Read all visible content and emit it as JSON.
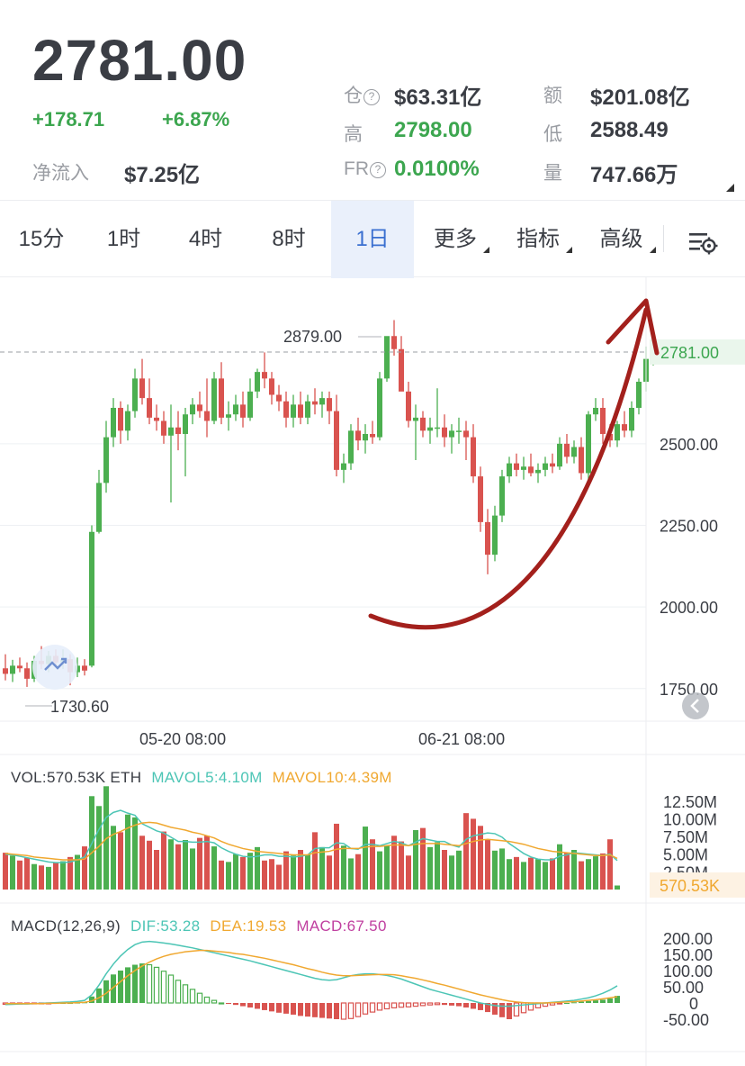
{
  "header": {
    "last_price": "2781.00",
    "change": "+178.71",
    "change_pct": "+6.87%",
    "net_inflow_label": "净流入",
    "net_inflow_value": "$7.25亿",
    "stats": [
      {
        "label": "仓",
        "has_info": true,
        "value": "$63.31亿",
        "color": "dark"
      },
      {
        "label": "额",
        "has_info": false,
        "value": "$201.08亿",
        "color": "dark"
      },
      {
        "label": "高",
        "has_info": false,
        "value": "2798.00",
        "color": "green"
      },
      {
        "label": "低",
        "has_info": false,
        "value": "2588.49",
        "color": "dark"
      },
      {
        "label": "FR",
        "has_info": true,
        "value": "0.0100%",
        "color": "green"
      },
      {
        "label": "量",
        "has_info": false,
        "value": "747.66万",
        "color": "dark"
      }
    ]
  },
  "tabs": [
    {
      "label": "15分",
      "active": false,
      "dropdown": false
    },
    {
      "label": "1时",
      "active": false,
      "dropdown": false
    },
    {
      "label": "4时",
      "active": false,
      "dropdown": false
    },
    {
      "label": "8时",
      "active": false,
      "dropdown": false
    },
    {
      "label": "1日",
      "active": true,
      "dropdown": false
    },
    {
      "label": "更多",
      "active": false,
      "dropdown": true
    },
    {
      "label": "指标",
      "active": false,
      "dropdown": true
    },
    {
      "label": "高级",
      "active": false,
      "dropdown": true
    }
  ],
  "settings_icon": "chart-settings-icon",
  "colors": {
    "up": "#4caf50",
    "down": "#d9534f",
    "accent": "#3a6fd0",
    "mavol5": "#4cc5b5",
    "mavol10": "#f0a830",
    "macd": "#c040a0",
    "annotation_arrow": "#a3201c"
  },
  "main_chart": {
    "type": "candlestick",
    "y_ticks": [
      "2500.00",
      "2250.00",
      "2000.00",
      "1750.00"
    ],
    "y_range": [
      1650,
      3010
    ],
    "current_price_label": "2781.00",
    "high_annotation": "2879.00",
    "low_annotation": "1730.60",
    "x_labels": [
      "05-20 08:00",
      "06-21 08:00"
    ],
    "grid": true,
    "annotation": "hand-drawn red upward arrow",
    "candles": [
      {
        "o": 1812,
        "h": 1855,
        "l": 1775,
        "c": 1795
      },
      {
        "o": 1795,
        "h": 1838,
        "l": 1770,
        "c": 1820
      },
      {
        "o": 1820,
        "h": 1845,
        "l": 1800,
        "c": 1812
      },
      {
        "o": 1812,
        "h": 1830,
        "l": 1755,
        "c": 1780
      },
      {
        "o": 1780,
        "h": 1850,
        "l": 1770,
        "c": 1835
      },
      {
        "o": 1835,
        "h": 1880,
        "l": 1810,
        "c": 1825
      },
      {
        "o": 1825,
        "h": 1865,
        "l": 1800,
        "c": 1850
      },
      {
        "o": 1850,
        "h": 1870,
        "l": 1815,
        "c": 1830
      },
      {
        "o": 1830,
        "h": 1870,
        "l": 1810,
        "c": 1840
      },
      {
        "o": 1840,
        "h": 1855,
        "l": 1760,
        "c": 1800
      },
      {
        "o": 1800,
        "h": 1845,
        "l": 1785,
        "c": 1820
      },
      {
        "o": 1820,
        "h": 1840,
        "l": 1790,
        "c": 1805
      },
      {
        "o": 1820,
        "h": 2250,
        "l": 1815,
        "c": 2230
      },
      {
        "o": 2230,
        "h": 2420,
        "l": 2225,
        "c": 2380
      },
      {
        "o": 2380,
        "h": 2570,
        "l": 2350,
        "c": 2520
      },
      {
        "o": 2520,
        "h": 2640,
        "l": 2490,
        "c": 2610
      },
      {
        "o": 2610,
        "h": 2630,
        "l": 2500,
        "c": 2540
      },
      {
        "o": 2540,
        "h": 2620,
        "l": 2510,
        "c": 2600
      },
      {
        "o": 2600,
        "h": 2730,
        "l": 2580,
        "c": 2700
      },
      {
        "o": 2700,
        "h": 2760,
        "l": 2620,
        "c": 2640
      },
      {
        "o": 2640,
        "h": 2700,
        "l": 2560,
        "c": 2580
      },
      {
        "o": 2580,
        "h": 2620,
        "l": 2540,
        "c": 2570
      },
      {
        "o": 2570,
        "h": 2600,
        "l": 2500,
        "c": 2525
      },
      {
        "o": 2525,
        "h": 2620,
        "l": 2320,
        "c": 2550
      },
      {
        "o": 2550,
        "h": 2600,
        "l": 2480,
        "c": 2530
      },
      {
        "o": 2530,
        "h": 2610,
        "l": 2400,
        "c": 2590
      },
      {
        "o": 2590,
        "h": 2640,
        "l": 2560,
        "c": 2620
      },
      {
        "o": 2620,
        "h": 2660,
        "l": 2580,
        "c": 2600
      },
      {
        "o": 2600,
        "h": 2700,
        "l": 2520,
        "c": 2570
      },
      {
        "o": 2570,
        "h": 2720,
        "l": 2560,
        "c": 2700
      },
      {
        "o": 2700,
        "h": 2750,
        "l": 2560,
        "c": 2580
      },
      {
        "o": 2580,
        "h": 2630,
        "l": 2540,
        "c": 2590
      },
      {
        "o": 2590,
        "h": 2650,
        "l": 2570,
        "c": 2620
      },
      {
        "o": 2620,
        "h": 2660,
        "l": 2550,
        "c": 2580
      },
      {
        "o": 2580,
        "h": 2700,
        "l": 2570,
        "c": 2660
      },
      {
        "o": 2660,
        "h": 2730,
        "l": 2640,
        "c": 2720
      },
      {
        "o": 2720,
        "h": 2780,
        "l": 2670,
        "c": 2700
      },
      {
        "o": 2700,
        "h": 2720,
        "l": 2620,
        "c": 2650
      },
      {
        "o": 2650,
        "h": 2680,
        "l": 2600,
        "c": 2630
      },
      {
        "o": 2630,
        "h": 2660,
        "l": 2550,
        "c": 2580
      },
      {
        "o": 2580,
        "h": 2650,
        "l": 2550,
        "c": 2620
      },
      {
        "o": 2620,
        "h": 2660,
        "l": 2560,
        "c": 2580
      },
      {
        "o": 2580,
        "h": 2650,
        "l": 2560,
        "c": 2630
      },
      {
        "o": 2630,
        "h": 2670,
        "l": 2590,
        "c": 2620
      },
      {
        "o": 2620,
        "h": 2660,
        "l": 2580,
        "c": 2640
      },
      {
        "o": 2640,
        "h": 2660,
        "l": 2560,
        "c": 2600
      },
      {
        "o": 2600,
        "h": 2650,
        "l": 2400,
        "c": 2420
      },
      {
        "o": 2420,
        "h": 2470,
        "l": 2380,
        "c": 2440
      },
      {
        "o": 2440,
        "h": 2560,
        "l": 2420,
        "c": 2540
      },
      {
        "o": 2540,
        "h": 2580,
        "l": 2480,
        "c": 2510
      },
      {
        "o": 2510,
        "h": 2560,
        "l": 2470,
        "c": 2530
      },
      {
        "o": 2530,
        "h": 2570,
        "l": 2500,
        "c": 2520
      },
      {
        "o": 2520,
        "h": 2720,
        "l": 2510,
        "c": 2700
      },
      {
        "o": 2700,
        "h": 2780,
        "l": 2690,
        "c": 2830
      },
      {
        "o": 2830,
        "h": 2879,
        "l": 2770,
        "c": 2790
      },
      {
        "o": 2790,
        "h": 2830,
        "l": 2730,
        "c": 2660
      },
      {
        "o": 2660,
        "h": 2690,
        "l": 2550,
        "c": 2570
      },
      {
        "o": 2570,
        "h": 2620,
        "l": 2450,
        "c": 2580
      },
      {
        "o": 2580,
        "h": 2600,
        "l": 2520,
        "c": 2540
      },
      {
        "o": 2540,
        "h": 2580,
        "l": 2500,
        "c": 2550
      },
      {
        "o": 2550,
        "h": 2670,
        "l": 2520,
        "c": 2550
      },
      {
        "o": 2550,
        "h": 2590,
        "l": 2490,
        "c": 2520
      },
      {
        "o": 2520,
        "h": 2560,
        "l": 2470,
        "c": 2540
      },
      {
        "o": 2540,
        "h": 2580,
        "l": 2500,
        "c": 2540
      },
      {
        "o": 2540,
        "h": 2570,
        "l": 2450,
        "c": 2520
      },
      {
        "o": 2520,
        "h": 2560,
        "l": 2380,
        "c": 2400
      },
      {
        "o": 2400,
        "h": 2430,
        "l": 2230,
        "c": 2260
      },
      {
        "o": 2260,
        "h": 2300,
        "l": 2100,
        "c": 2160
      },
      {
        "o": 2160,
        "h": 2310,
        "l": 2140,
        "c": 2280
      },
      {
        "o": 2280,
        "h": 2420,
        "l": 2260,
        "c": 2400
      },
      {
        "o": 2400,
        "h": 2460,
        "l": 2380,
        "c": 2440
      },
      {
        "o": 2440,
        "h": 2470,
        "l": 2400,
        "c": 2420
      },
      {
        "o": 2420,
        "h": 2460,
        "l": 2390,
        "c": 2430
      },
      {
        "o": 2430,
        "h": 2470,
        "l": 2400,
        "c": 2410
      },
      {
        "o": 2410,
        "h": 2440,
        "l": 2380,
        "c": 2420
      },
      {
        "o": 2420,
        "h": 2460,
        "l": 2400,
        "c": 2440
      },
      {
        "o": 2440,
        "h": 2470,
        "l": 2410,
        "c": 2430
      },
      {
        "o": 2430,
        "h": 2520,
        "l": 2420,
        "c": 2500
      },
      {
        "o": 2500,
        "h": 2530,
        "l": 2440,
        "c": 2460
      },
      {
        "o": 2460,
        "h": 2510,
        "l": 2440,
        "c": 2490
      },
      {
        "o": 2490,
        "h": 2520,
        "l": 2390,
        "c": 2410
      },
      {
        "o": 2410,
        "h": 2600,
        "l": 2380,
        "c": 2590
      },
      {
        "o": 2590,
        "h": 2640,
        "l": 2570,
        "c": 2610
      },
      {
        "o": 2610,
        "h": 2640,
        "l": 2500,
        "c": 2530
      },
      {
        "o": 2530,
        "h": 2560,
        "l": 2490,
        "c": 2510
      },
      {
        "o": 2510,
        "h": 2570,
        "l": 2490,
        "c": 2560
      },
      {
        "o": 2560,
        "h": 2600,
        "l": 2520,
        "c": 2540
      },
      {
        "o": 2540,
        "h": 2630,
        "l": 2520,
        "c": 2610
      },
      {
        "o": 2610,
        "h": 2700,
        "l": 2590,
        "c": 2690
      },
      {
        "o": 2690,
        "h": 2798,
        "l": 2660,
        "c": 2760
      },
      {
        "o": 2760,
        "h": 2800,
        "l": 2740,
        "c": 2781
      }
    ]
  },
  "volume": {
    "label": "VOL:570.53K ETH",
    "mavol5_label": "MAVOL5:4.10M",
    "mavol10_label": "MAVOL10:4.39M",
    "y_ticks": [
      "12.50M",
      "10.00M",
      "7.50M",
      "5.00M",
      "2.50M"
    ],
    "current_label": "570.53K",
    "values": [
      5.2,
      4.8,
      4.1,
      4.5,
      3.6,
      3.4,
      3.2,
      3.8,
      4.0,
      4.6,
      4.9,
      6.1,
      13.2,
      11.8,
      14.6,
      9.0,
      8.1,
      10.6,
      10.2,
      7.6,
      6.9,
      5.6,
      8.2,
      7.1,
      6.4,
      7.0,
      5.8,
      7.3,
      7.6,
      6.1,
      4.1,
      3.9,
      5.0,
      4.6,
      5.2,
      6.0,
      4.1,
      4.3,
      3.5,
      5.4,
      4.8,
      5.6,
      4.9,
      8.1,
      6.0,
      4.8,
      9.3,
      6.2,
      4.4,
      5.0,
      8.9,
      7.1,
      5.4,
      6.2,
      7.6,
      6.8,
      4.8,
      8.4,
      8.7,
      6.0,
      6.7,
      5.6,
      4.8,
      5.5,
      10.8,
      10.0,
      9.0,
      7.1,
      5.5,
      5.8,
      4.3,
      4.6,
      3.9,
      4.5,
      4.3,
      3.9,
      4.4,
      6.4,
      5.2,
      5.6,
      4.0,
      4.3,
      4.7,
      5.1,
      7.1,
      0.57
    ],
    "mavol5": [
      5.0,
      4.9,
      4.7,
      4.5,
      4.3,
      4.1,
      3.9,
      3.8,
      3.8,
      3.9,
      4.2,
      4.6,
      6.5,
      8.5,
      10.2,
      10.9,
      11.2,
      10.8,
      10.5,
      9.3,
      8.8,
      8.3,
      8.0,
      7.4,
      6.8,
      6.8,
      6.7,
      6.7,
      6.8,
      6.6,
      5.9,
      5.4,
      5.0,
      4.7,
      4.6,
      4.7,
      4.9,
      4.9,
      4.7,
      4.7,
      4.6,
      4.7,
      4.9,
      5.8,
      5.9,
      5.9,
      6.6,
      6.5,
      5.8,
      5.7,
      6.4,
      6.4,
      6.2,
      6.5,
      6.8,
      6.6,
      6.2,
      6.7,
      7.2,
      7.0,
      6.8,
      6.8,
      6.3,
      6.0,
      7.1,
      7.6,
      7.8,
      8.0,
      7.9,
      7.4,
      6.5,
      5.8,
      5.1,
      4.6,
      4.3,
      4.2,
      4.2,
      4.7,
      4.9,
      5.2,
      5.1,
      5.0,
      4.9,
      4.8,
      5.0,
      4.1
    ],
    "mavol10": [
      5.1,
      5.0,
      4.9,
      4.8,
      4.6,
      4.5,
      4.4,
      4.3,
      4.2,
      4.2,
      4.2,
      4.3,
      5.2,
      6.1,
      7.2,
      7.8,
      8.2,
      8.7,
      9.1,
      9.4,
      9.5,
      9.4,
      9.1,
      8.8,
      8.6,
      8.4,
      8.1,
      7.9,
      7.6,
      7.3,
      6.8,
      6.4,
      6.1,
      5.8,
      5.6,
      5.4,
      5.3,
      5.2,
      5.1,
      5.0,
      4.9,
      4.9,
      4.9,
      5.2,
      5.3,
      5.4,
      5.7,
      5.8,
      5.8,
      5.8,
      6.0,
      6.1,
      6.1,
      6.2,
      6.3,
      6.3,
      6.2,
      6.4,
      6.5,
      6.5,
      6.5,
      6.4,
      6.3,
      6.2,
      6.5,
      6.8,
      7.0,
      7.1,
      7.0,
      6.9,
      6.8,
      6.6,
      6.4,
      6.1,
      5.8,
      5.6,
      5.4,
      5.3,
      5.2,
      5.1,
      5.0,
      4.9,
      4.8,
      4.8,
      4.9,
      4.4
    ]
  },
  "macd": {
    "label": "MACD(12,26,9)",
    "dif_label": "DIF:53.28",
    "dea_label": "DEA:19.53",
    "macd_label": "MACD:67.50",
    "y_ticks": [
      "200.00",
      "150.00",
      "100.00",
      "50.00",
      "0",
      "-50.00"
    ],
    "hist": [
      -4,
      -3,
      -3,
      -2,
      -2,
      -1,
      -1,
      0,
      0,
      0,
      1,
      2,
      20,
      45,
      70,
      88,
      100,
      110,
      118,
      122,
      118,
      110,
      98,
      86,
      70,
      56,
      42,
      30,
      18,
      8,
      0,
      -3,
      -6,
      -10,
      -14,
      -18,
      -22,
      -26,
      -30,
      -33,
      -36,
      -40,
      -42,
      -44,
      -46,
      -48,
      -50,
      -50,
      -48,
      -42,
      -34,
      -28,
      -22,
      -18,
      -15,
      -13,
      -12,
      -10,
      -8,
      -6,
      -5,
      -6,
      -8,
      -10,
      -14,
      -18,
      -22,
      -28,
      -36,
      -44,
      -50,
      -40,
      -30,
      -22,
      -15,
      -10,
      -6,
      -3,
      0,
      2,
      4,
      6,
      8,
      10,
      14,
      22
    ],
    "dif": [
      -5,
      -4,
      -3,
      -3,
      -2,
      -1,
      0,
      1,
      2,
      3,
      5,
      8,
      25,
      55,
      90,
      120,
      145,
      165,
      180,
      188,
      190,
      188,
      185,
      182,
      178,
      174,
      170,
      165,
      160,
      155,
      150,
      145,
      140,
      135,
      130,
      124,
      118,
      112,
      106,
      100,
      94,
      88,
      82,
      76,
      72,
      70,
      72,
      78,
      84,
      88,
      90,
      90,
      88,
      85,
      80,
      74,
      66,
      58,
      50,
      42,
      36,
      30,
      24,
      18,
      12,
      6,
      0,
      -4,
      -8,
      -10,
      -10,
      -8,
      -6,
      -4,
      -2,
      0,
      2,
      4,
      6,
      8,
      12,
      16,
      22,
      30,
      40,
      53
    ],
    "dea": [
      -2,
      -2,
      -2,
      -2,
      -2,
      -2,
      -1,
      -1,
      0,
      0,
      1,
      2,
      6,
      16,
      30,
      48,
      66,
      84,
      100,
      114,
      126,
      136,
      144,
      150,
      154,
      158,
      160,
      162,
      162,
      160,
      158,
      156,
      152,
      150,
      146,
      142,
      138,
      133,
      128,
      123,
      118,
      112,
      106,
      101,
      95,
      90,
      86,
      84,
      84,
      85,
      86,
      87,
      88,
      88,
      87,
      84,
      80,
      76,
      71,
      66,
      60,
      55,
      49,
      43,
      37,
      31,
      25,
      20,
      15,
      10,
      6,
      3,
      1,
      0,
      0,
      0,
      1,
      2,
      3,
      4,
      6,
      8,
      10,
      13,
      16,
      19.53
    ]
  }
}
